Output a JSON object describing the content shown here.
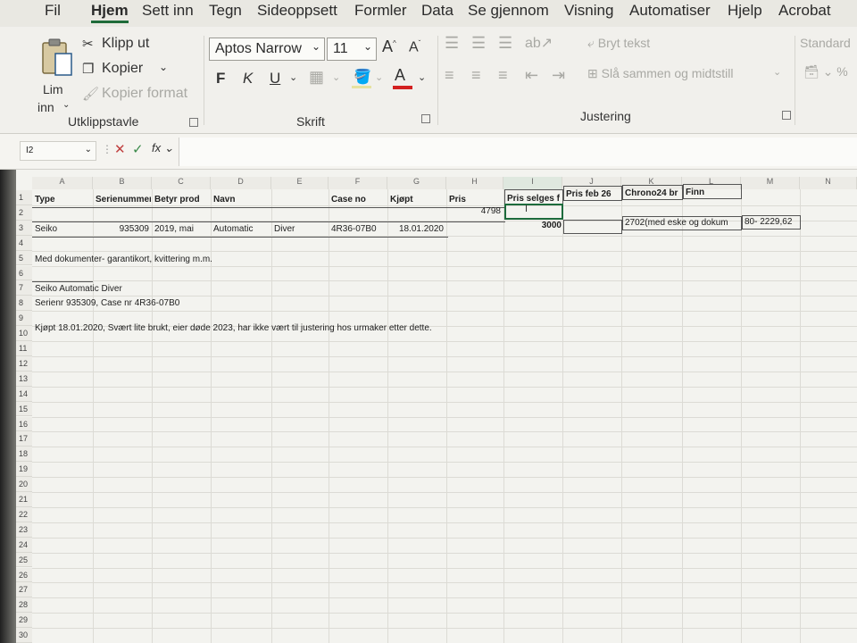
{
  "menu": {
    "tabs": [
      "Fil",
      "Hjem",
      "Sett inn",
      "Tegn",
      "Sideoppsett",
      "Formler",
      "Data",
      "Se gjennom",
      "Visning",
      "Automatiser",
      "Hjelp",
      "Acrobat"
    ],
    "active": "Hjem"
  },
  "ribbon": {
    "clipboard": {
      "paste_label": "Lim",
      "paste_label2": "inn",
      "cut": "Klipp ut",
      "copy": "Kopier",
      "format_painter": "Kopier format",
      "group_label": "Utklippstavle"
    },
    "font": {
      "font_name": "Aptos Narrow",
      "font_size": "11",
      "bold": "F",
      "italic": "K",
      "underline": "U",
      "group_label": "Skrift",
      "font_color": "#d32020"
    },
    "alignment": {
      "wrap_text": "Bryt tekst",
      "merge_center": "Slå sammen og midtstill",
      "group_label": "Justering"
    },
    "number": {
      "format": "Standard"
    }
  },
  "formula_bar": {
    "name_box": "I2",
    "fx": "fx",
    "value": ""
  },
  "sheet": {
    "columns": [
      "A",
      "B",
      "C",
      "D",
      "E",
      "F",
      "G",
      "H",
      "I",
      "J",
      "K",
      "L",
      "M",
      "N"
    ],
    "rows": [
      "1",
      "2",
      "3",
      "4",
      "5",
      "6",
      "7",
      "8",
      "9",
      "10",
      "11",
      "12",
      "13",
      "14",
      "15",
      "16",
      "17",
      "18",
      "19",
      "20",
      "21",
      "22",
      "23",
      "24",
      "25",
      "26",
      "27",
      "28",
      "29",
      "30"
    ],
    "header_row": [
      "Type",
      "Serienummer",
      "Betyr prod",
      "Navn",
      "",
      "Case no",
      "Kjøpt",
      "Pris",
      "Pris selges f",
      "Pris feb 26",
      "Chrono24 br",
      "Finn"
    ],
    "row2": {
      "H": "4798"
    },
    "row3": {
      "A": "Seiko",
      "B": "935309",
      "C": "2019, mai",
      "D": "Automatic",
      "E": "Diver",
      "F": "4R36-07B0",
      "G": "18.01.2020",
      "I": "3000",
      "K": "2702(med eske og dokum",
      "L": "80- 2229,62"
    },
    "notes": {
      "A5": "Med dokumenter- garantikort, kvittering m.m.",
      "A7": "Seiko Automatic Diver",
      "A8": "Serienr 935309, Case nr 4R36-07B0",
      "A10": "Kjøpt 18.01.2020, Svært lite brukt, eier døde 2023, har ikke vært til justering hos urmaker etter dette."
    },
    "active_cell": "I2",
    "accent": "#1d6b3c"
  }
}
